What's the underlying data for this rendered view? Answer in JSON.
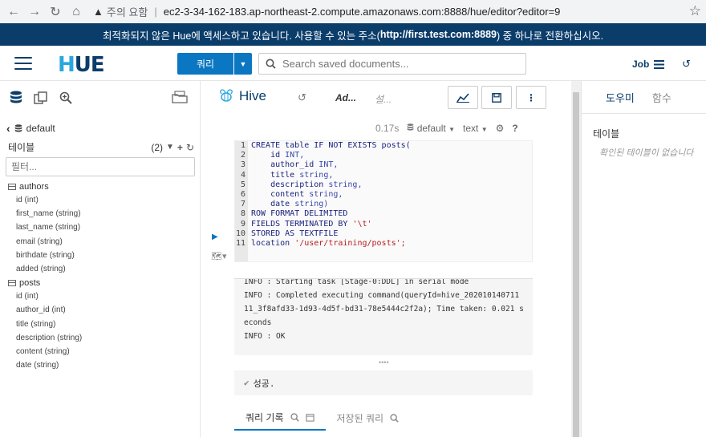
{
  "browser": {
    "warning_text": "주의 요함",
    "url": "ec2-3-34-162-183.ap-northeast-2.compute.amazonaws.com:8888/hue/editor?editor=9"
  },
  "banner": {
    "prefix": "최적화되지 않은 Hue에 액세스하고 있습니다. 사용할 수 있는 주소(",
    "link": "http://first.test.com:8889",
    "suffix": ") 중 하나로 전환하십시오."
  },
  "header": {
    "logo_h": "H",
    "logo_rest": "UE",
    "query_label": "쿼리",
    "search_placeholder": "Search saved documents...",
    "job_label": "Job"
  },
  "left": {
    "database": "default",
    "tables_label": "테이블",
    "tables_count": "(2)",
    "filter_placeholder": "필터...",
    "tables": [
      {
        "name": "authors",
        "columns": [
          "id (int)",
          "first_name (string)",
          "last_name (string)",
          "email (string)",
          "birthdate (string)",
          "added (string)"
        ]
      },
      {
        "name": "posts",
        "columns": [
          "id (int)",
          "author_id (int)",
          "title (string)",
          "description (string)",
          "content (string)",
          "date (string)"
        ]
      }
    ]
  },
  "editor": {
    "title": "Hive",
    "add_label": "Ad...",
    "desc_label": "설...",
    "time": "0.17s",
    "database": "default",
    "format": "text",
    "code": [
      [
        "CREATE table IF NOT EXISTS posts(",
        ""
      ],
      [
        "    id ",
        "INT,"
      ],
      [
        "    author_id ",
        "INT,"
      ],
      [
        "    title ",
        "string,"
      ],
      [
        "    description ",
        "string,"
      ],
      [
        "    content ",
        "string,"
      ],
      [
        "    date ",
        "string)"
      ],
      [
        "ROW FORMAT DELIMITED",
        ""
      ],
      [
        "FIELDS TERMINATED BY ",
        "'\\t'"
      ],
      [
        "STORED AS TEXTFILE",
        ""
      ],
      [
        "location ",
        "'/user/training/posts';"
      ]
    ],
    "log": [
      "INFO  : Starting task [Stage-0:DDL] in serial mode",
      "INFO  : Completed executing command(queryId=hive_202010140711",
      "11_3f8afd33-1d93-4d5f-bd31-78e5444c2f2a); Time taken: 0.021 s",
      "econds",
      "INFO  : OK"
    ],
    "success": "성공.",
    "tab_history": "쿼리 기록",
    "tab_saved": "저장된 쿼리"
  },
  "right": {
    "tab_assist": "도우미",
    "tab_functions": "함수",
    "tables_label": "테이블",
    "empty": "확인된 테이블이 없습니다"
  }
}
